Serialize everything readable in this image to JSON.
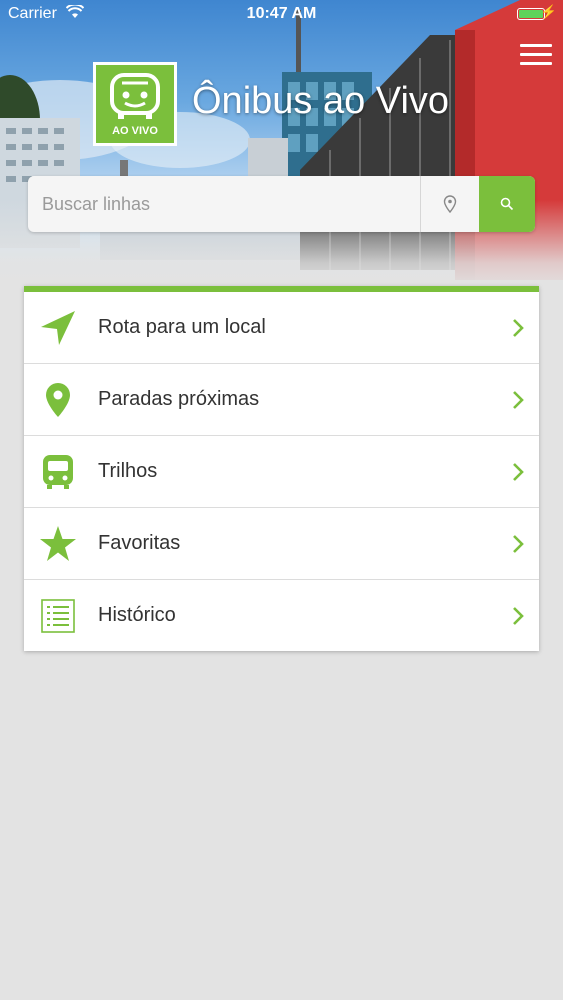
{
  "status_bar": {
    "carrier": "Carrier",
    "time": "10:47 AM"
  },
  "header": {
    "app_title": "Ônibus ao Vivo",
    "logo_text": "AO VIVO"
  },
  "search": {
    "placeholder": "Buscar linhas",
    "value": ""
  },
  "menu": {
    "items": [
      {
        "label": "Rota para um local",
        "icon": "navigation-arrow-icon"
      },
      {
        "label": "Paradas próximas",
        "icon": "location-pin-icon"
      },
      {
        "label": "Trilhos",
        "icon": "train-icon"
      },
      {
        "label": "Favoritas",
        "icon": "star-icon"
      },
      {
        "label": "Histórico",
        "icon": "history-list-icon"
      }
    ]
  },
  "colors": {
    "accent": "#7bbf3c",
    "background": "#e3e3e3",
    "text": "#333333"
  }
}
